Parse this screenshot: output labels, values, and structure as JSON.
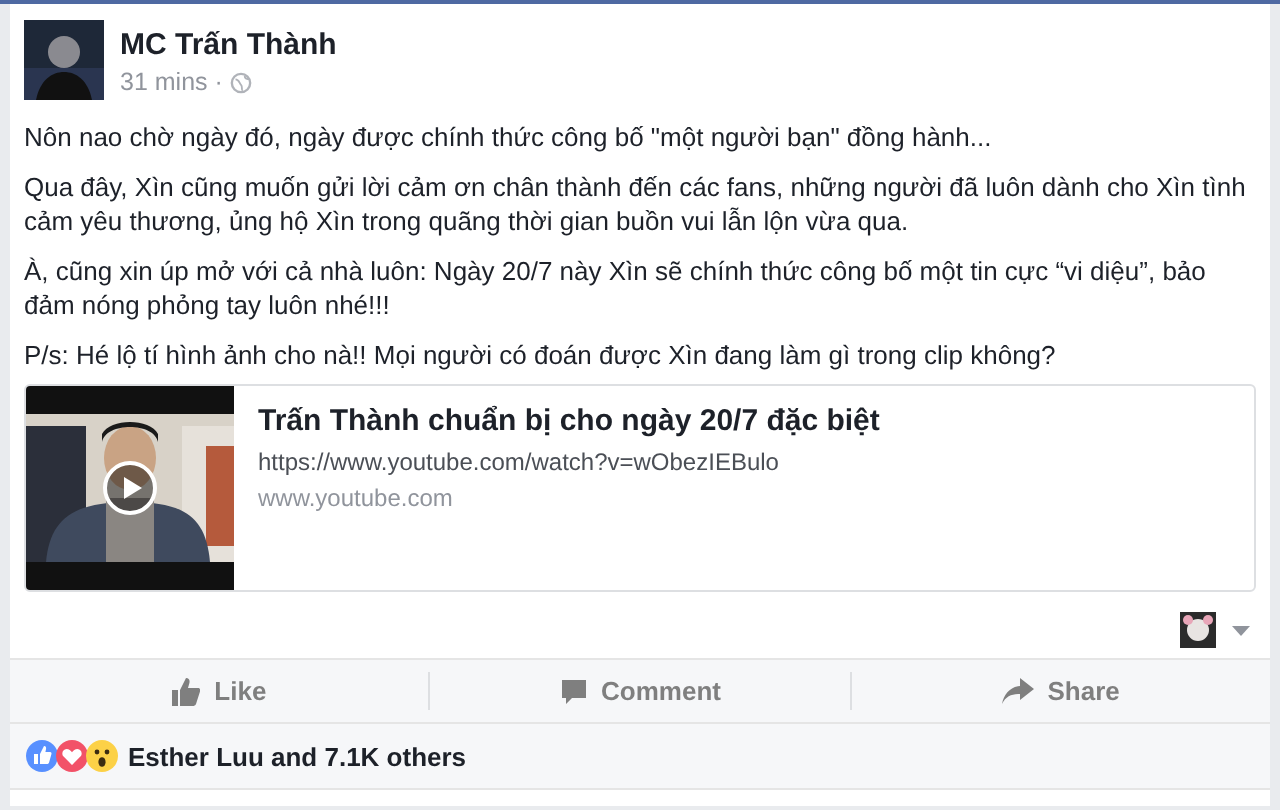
{
  "post": {
    "author": "MC Trấn Thành",
    "time": "31 mins ·",
    "paragraphs": [
      "Nôn nao chờ ngày đó, ngày được chính thức công bố \"một người bạn\" đồng hành...",
      "Qua đây, Xìn cũng muốn gửi lời cảm ơn chân thành đến các fans, những người đã luôn dành cho Xìn tình cảm yêu thương, ủng hộ Xìn trong quãng thời gian buồn vui lẫn lộn vừa qua.",
      "À, cũng xin úp mở với cả nhà luôn: Ngày 20/7 này Xìn sẽ chính thức công bố một tin cực “vi diệu”, bảo đảm nóng phỏng tay luôn nhé!!!",
      "P/s: Hé lộ tí hình ảnh cho nà!! Mọi người có đoán được Xìn đang làm gì trong clip không?"
    ],
    "link_preview": {
      "title": "Trấn Thành chuẩn bị cho ngày 20/7 đặc biệt",
      "url": "https://www.youtube.com/watch?v=wObezIEBulo",
      "domain": "www.youtube.com"
    }
  },
  "actions": [
    {
      "kind": "like",
      "label": "Like"
    },
    {
      "kind": "comment",
      "label": "Comment"
    },
    {
      "kind": "share",
      "label": "Share"
    }
  ],
  "reactions": {
    "types": [
      {
        "kind": "like"
      },
      {
        "kind": "love"
      },
      {
        "kind": "wow"
      }
    ],
    "summary": "Esther Luu and 7.1K others"
  }
}
